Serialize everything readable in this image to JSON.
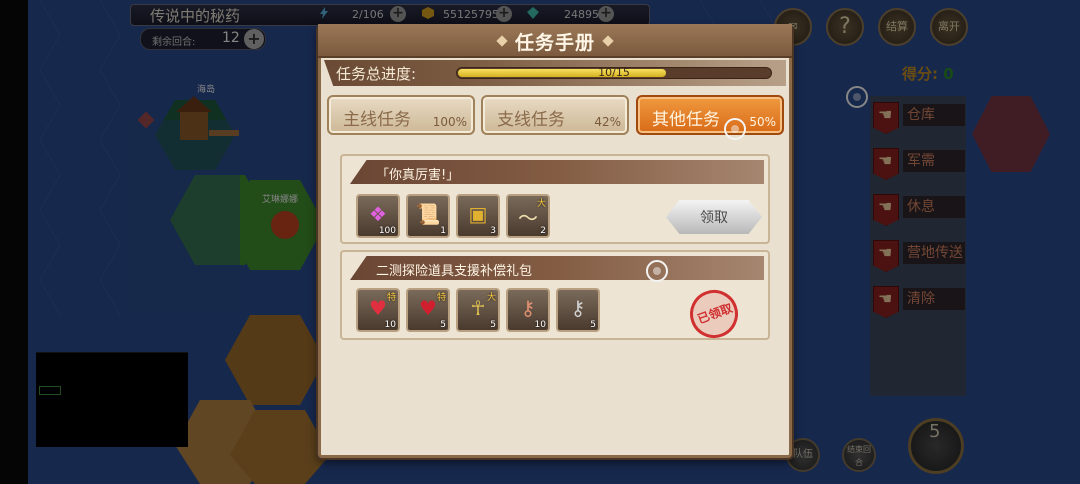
{
  "hud": {
    "location_title": "传说中的秘药",
    "stamina": "2/106",
    "gold": "55125795",
    "gems": "24895",
    "turns_label": "剩余回合:",
    "turns_value": "12"
  },
  "right_hud": {
    "score_label": "得分:",
    "score_value": "0",
    "btn_end": "结算",
    "btn_leave": "离开",
    "side_items": [
      "仓库",
      "军需",
      "休息",
      "营地传送",
      "清除"
    ],
    "bottom_btn_team": "队伍",
    "bottom_btn_end_turn": "结束回合",
    "big_btn_num": "5"
  },
  "map": {
    "labels": [
      "海岛",
      "艾琳娜娜"
    ]
  },
  "modal": {
    "title": "任务手册",
    "progress_label": "任务总进度:",
    "progress_text": "10/15",
    "progress_fraction": 0.667,
    "tabs": [
      {
        "label": "主线任务",
        "pct": "100%",
        "active": false
      },
      {
        "label": "支线任务",
        "pct": "42%",
        "active": false
      },
      {
        "label": "其他任务",
        "pct": "50%",
        "active": true
      }
    ],
    "tasks": [
      {
        "title": "「你真厉害!」",
        "claim_label": "领取",
        "items": [
          {
            "icon": "gem-cluster-icon",
            "count": "100",
            "badge": ""
          },
          {
            "icon": "scroll-icon",
            "count": "1",
            "badge": ""
          },
          {
            "icon": "treasure-chest-icon",
            "count": "3",
            "badge": ""
          },
          {
            "icon": "feather-quill-icon",
            "count": "2",
            "badge": "大"
          }
        ]
      },
      {
        "title": "二测探险道具支援补偿礼包",
        "stamp_label": "已领取",
        "items": [
          {
            "icon": "potion-icon",
            "count": "10",
            "badge": "特"
          },
          {
            "icon": "potion-icon",
            "count": "5",
            "badge": "特"
          },
          {
            "icon": "ankh-icon",
            "count": "5",
            "badge": "大"
          },
          {
            "icon": "key-icon",
            "count": "10",
            "badge": ""
          },
          {
            "icon": "key-icon",
            "count": "5",
            "badge": ""
          }
        ]
      }
    ]
  }
}
